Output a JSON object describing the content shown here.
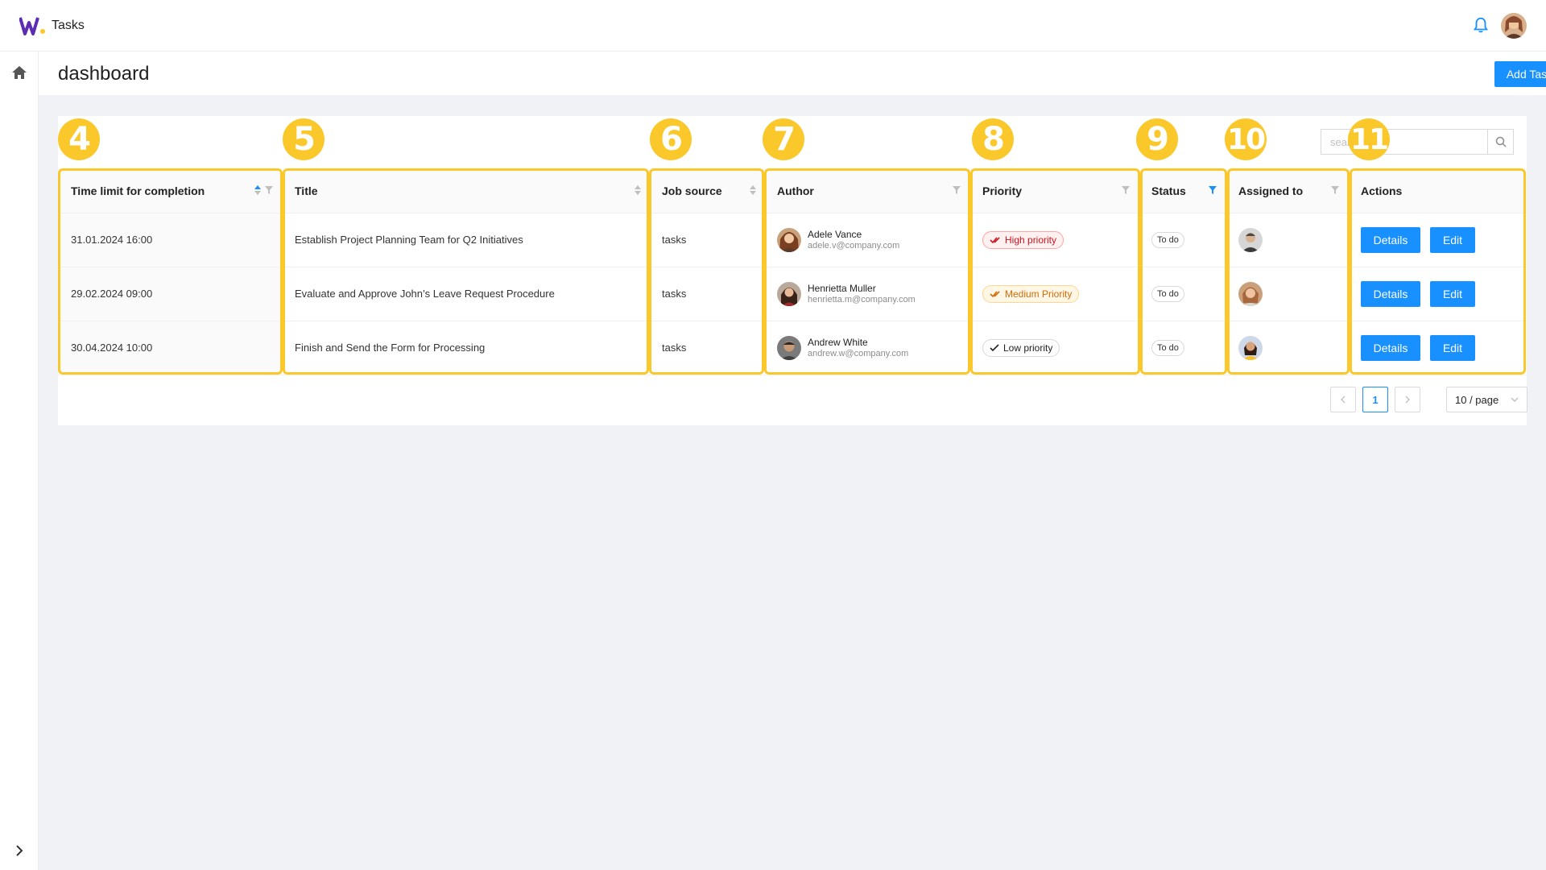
{
  "app": {
    "title": "Tasks",
    "logo": "W."
  },
  "page": {
    "title": "dashboard",
    "add_task_label": "Add Task"
  },
  "search": {
    "placeholder": "search"
  },
  "table": {
    "columns": [
      "Time limit for completion",
      "Title",
      "Job source",
      "Author",
      "Priority",
      "Status",
      "Assigned to",
      "Actions"
    ],
    "rows": [
      {
        "time": "31.01.2024 16:00",
        "title": "Establish Project Planning Team for Q2 Initiatives",
        "source": "tasks",
        "author_name": "Adele Vance",
        "author_email": "adele.v@company.com",
        "priority": "High priority",
        "priority_level": "high",
        "status": "To do"
      },
      {
        "time": "29.02.2024 09:00",
        "title": "Evaluate and Approve John’s Leave Request Procedure",
        "source": "tasks",
        "author_name": "Henrietta Muller",
        "author_email": "henrietta.m@company.com",
        "priority": "Medium Priority",
        "priority_level": "medium",
        "status": "To do"
      },
      {
        "time": "30.04.2024 10:00",
        "title": "Finish and Send the Form for Processing",
        "source": "tasks",
        "author_name": "Andrew White",
        "author_email": "andrew.w@company.com",
        "priority": "Low priority",
        "priority_level": "low",
        "status": "To do"
      }
    ],
    "details_label": "Details",
    "edit_label": "Edit"
  },
  "pagination": {
    "current_page": "1",
    "page_size": "10 / page"
  },
  "annotations": [
    "4",
    "5",
    "6",
    "7",
    "8",
    "9",
    "10",
    "11"
  ],
  "colors": {
    "primary": "#1890ff",
    "annotation": "#fbc82b",
    "high": "#cf1322",
    "medium": "#d46b08"
  }
}
